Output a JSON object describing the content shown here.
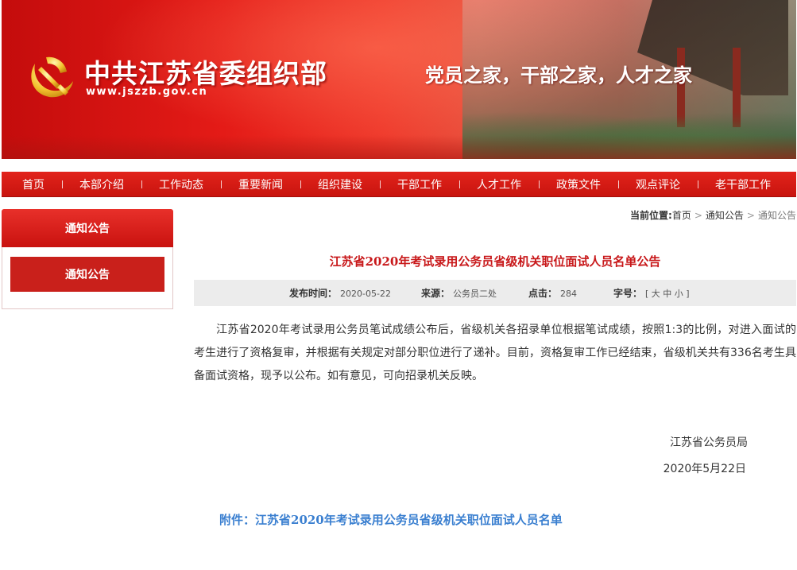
{
  "header": {
    "site_title": "中共江苏省委组织部",
    "site_url": "www.jszzb.gov.cn",
    "slogan": "党员之家，干部之家，人才之家"
  },
  "nav": {
    "items": [
      "首页",
      "本部介绍",
      "工作动态",
      "重要新闻",
      "组织建设",
      "干部工作",
      "人才工作",
      "政策文件",
      "观点评论",
      "老干部工作"
    ]
  },
  "sidebar": {
    "heading": "通知公告",
    "items": [
      {
        "label": "通知公告"
      }
    ]
  },
  "breadcrumb": {
    "label": "当前位置:",
    "items": [
      "首页",
      "通知公告",
      "通知公告"
    ]
  },
  "article": {
    "title": "江苏省2020年考试录用公务员省级机关职位面试人员名单公告",
    "meta": {
      "publish_label": "发布时间：",
      "publish_value": "2020-05-22",
      "source_label": "来源：",
      "source_value": "公务员二处",
      "clicks_label": "点击：",
      "clicks_value": "284",
      "fontsize_label": "字号：",
      "fontsize_value": "[ 大 中 小 ]"
    },
    "body": "江苏省2020年考试录用公务员笔试成绩公布后，省级机关各招录单位根据笔试成绩，按照1:3的比例，对进入面试的考生进行了资格复审，并根据有关规定对部分职位进行了递补。目前，资格复审工作已经结束，省级机关共有336名考生具备面试资格，现予以公布。如有意见，可向招录机关反映。",
    "signature": "江苏省公务员局",
    "date": "2020年5月22日",
    "attachment": "附件：江苏省2020年考试录用公务员省级机关职位面试人员名单"
  },
  "colors": {
    "brand_red": "#d41a14",
    "title_red": "#c8181a",
    "link_blue": "#3a7fd0"
  }
}
